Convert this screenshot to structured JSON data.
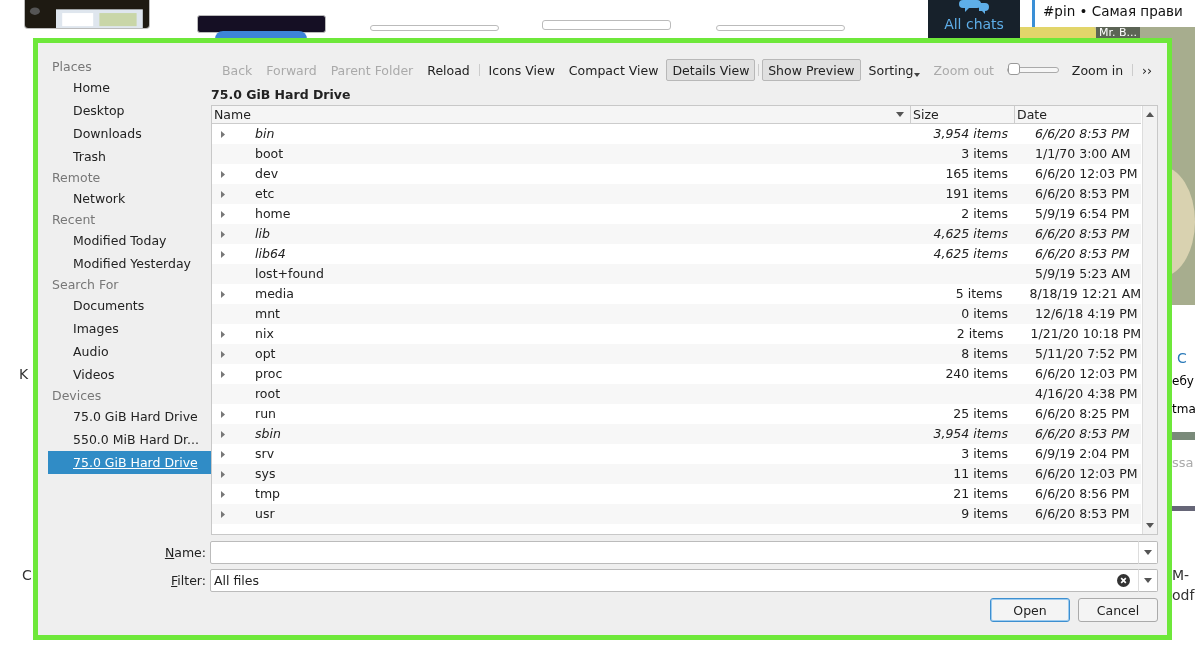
{
  "desktop": {
    "labels": [
      {
        "text": "K",
        "kind": "file"
      },
      {
        "text": "C",
        "kind": "file"
      },
      {
        "text": "M-",
        "kind": "file"
      },
      {
        "text": "odf",
        "kind": "file"
      }
    ],
    "chat": {
      "tab": "All chats",
      "pinned": "#pin • Самая прави",
      "sender": "Mr. B...",
      "link": "C",
      "line_1": "ебу",
      "line_2": "tma",
      "placeholder": "ssa"
    }
  },
  "dialog": {
    "sidebar": [
      {
        "label": "Places",
        "items": [
          {
            "label": "Home",
            "selected": false
          },
          {
            "label": "Desktop",
            "selected": false
          },
          {
            "label": "Downloads",
            "selected": false
          },
          {
            "label": "Trash",
            "selected": false
          }
        ]
      },
      {
        "label": "Remote",
        "items": [
          {
            "label": "Network",
            "selected": false
          }
        ]
      },
      {
        "label": "Recent",
        "items": [
          {
            "label": "Modified Today",
            "selected": false
          },
          {
            "label": "Modified Yesterday",
            "selected": false
          }
        ]
      },
      {
        "label": "Search For",
        "items": [
          {
            "label": "Documents",
            "selected": false
          },
          {
            "label": "Images",
            "selected": false
          },
          {
            "label": "Audio",
            "selected": false
          },
          {
            "label": "Videos",
            "selected": false
          }
        ]
      },
      {
        "label": "Devices",
        "items": [
          {
            "label": "75.0 GiB Hard Drive",
            "selected": false
          },
          {
            "label": "550.0 MiB Hard Dr...",
            "selected": false
          },
          {
            "label": "75.0 GiB Hard Drive",
            "selected": true
          }
        ]
      }
    ],
    "toolbar": [
      {
        "label": "Back",
        "kind": "button",
        "disabled": true,
        "pressed": false
      },
      {
        "label": "Forward",
        "kind": "button",
        "disabled": true,
        "pressed": false
      },
      {
        "label": "Parent Folder",
        "kind": "button",
        "disabled": true,
        "pressed": false
      },
      {
        "label": "Reload",
        "kind": "button",
        "disabled": false,
        "pressed": false
      },
      {
        "kind": "separator"
      },
      {
        "label": "Icons View",
        "kind": "button",
        "disabled": false,
        "pressed": false
      },
      {
        "label": "Compact View",
        "kind": "button",
        "disabled": false,
        "pressed": false
      },
      {
        "label": "Details View",
        "kind": "button",
        "disabled": false,
        "pressed": true
      },
      {
        "kind": "separator"
      },
      {
        "label": "Show Preview",
        "kind": "button",
        "disabled": false,
        "pressed": true
      },
      {
        "label": "Sorting",
        "kind": "menu",
        "disabled": false,
        "pressed": false
      },
      {
        "label": "Zoom out",
        "kind": "button",
        "disabled": true,
        "pressed": false
      },
      {
        "kind": "slider",
        "level": 0
      },
      {
        "label": "Zoom in",
        "kind": "button",
        "disabled": false,
        "pressed": false
      },
      {
        "kind": "separator"
      },
      {
        "label": "››",
        "kind": "button",
        "disabled": false,
        "pressed": false
      }
    ],
    "location": "75.0 GiB Hard Drive",
    "table": {
      "columns": [
        "Name",
        "Size",
        "Date"
      ],
      "rows": [
        {
          "name": "bin",
          "size": "3,954 items",
          "date": "6/6/20 8:53 PM",
          "link": true,
          "expandable": true
        },
        {
          "name": "boot",
          "size": "3 items",
          "date": "1/1/70 3:00 AM",
          "link": false,
          "expandable": false
        },
        {
          "name": "dev",
          "size": "165 items",
          "date": "6/6/20 12:03 PM",
          "link": false,
          "expandable": true
        },
        {
          "name": "etc",
          "size": "191 items",
          "date": "6/6/20 8:53 PM",
          "link": false,
          "expandable": true
        },
        {
          "name": "home",
          "size": "2 items",
          "date": "5/9/19 6:54 PM",
          "link": false,
          "expandable": true
        },
        {
          "name": "lib",
          "size": "4,625 items",
          "date": "6/6/20 8:53 PM",
          "link": true,
          "expandable": true
        },
        {
          "name": "lib64",
          "size": "4,625 items",
          "date": "6/6/20 8:53 PM",
          "link": true,
          "expandable": true
        },
        {
          "name": "lost+found",
          "date": "5/9/19 5:23 AM",
          "link": false,
          "expandable": false
        },
        {
          "name": "media",
          "size": "5 items",
          "date": "8/18/19 12:21 AM",
          "link": false,
          "expandable": true
        },
        {
          "name": "mnt",
          "size": "0 items",
          "date": "12/6/18 4:19 PM",
          "link": false,
          "expandable": false
        },
        {
          "name": "nix",
          "size": "2 items",
          "date": "1/21/20 10:18 PM",
          "link": false,
          "expandable": true
        },
        {
          "name": "opt",
          "size": "8 items",
          "date": "5/11/20 7:52 PM",
          "link": false,
          "expandable": true
        },
        {
          "name": "proc",
          "size": "240 items",
          "date": "6/6/20 12:03 PM",
          "link": false,
          "expandable": true
        },
        {
          "name": "root",
          "date": "4/16/20 4:38 PM",
          "link": false,
          "expandable": false
        },
        {
          "name": "run",
          "size": "25 items",
          "date": "6/6/20 8:25 PM",
          "link": false,
          "expandable": true
        },
        {
          "name": "sbin",
          "size": "3,954 items",
          "date": "6/6/20 8:53 PM",
          "link": true,
          "expandable": true
        },
        {
          "name": "srv",
          "size": "3 items",
          "date": "6/9/19 2:04 PM",
          "link": false,
          "expandable": true
        },
        {
          "name": "sys",
          "size": "11 items",
          "date": "6/6/20 12:03 PM",
          "link": false,
          "expandable": true
        },
        {
          "name": "tmp",
          "size": "21 items",
          "date": "6/6/20 8:56 PM",
          "link": false,
          "expandable": true
        },
        {
          "name": "usr",
          "size": "9 items",
          "date": "6/6/20 8:53 PM",
          "link": false,
          "expandable": true
        }
      ]
    },
    "name_label": "Name:",
    "filter_label": "Filter:",
    "filter_value": "All files",
    "buttons": [
      {
        "label": "Open",
        "default": true
      },
      {
        "label": "Cancel",
        "default": false
      }
    ]
  }
}
